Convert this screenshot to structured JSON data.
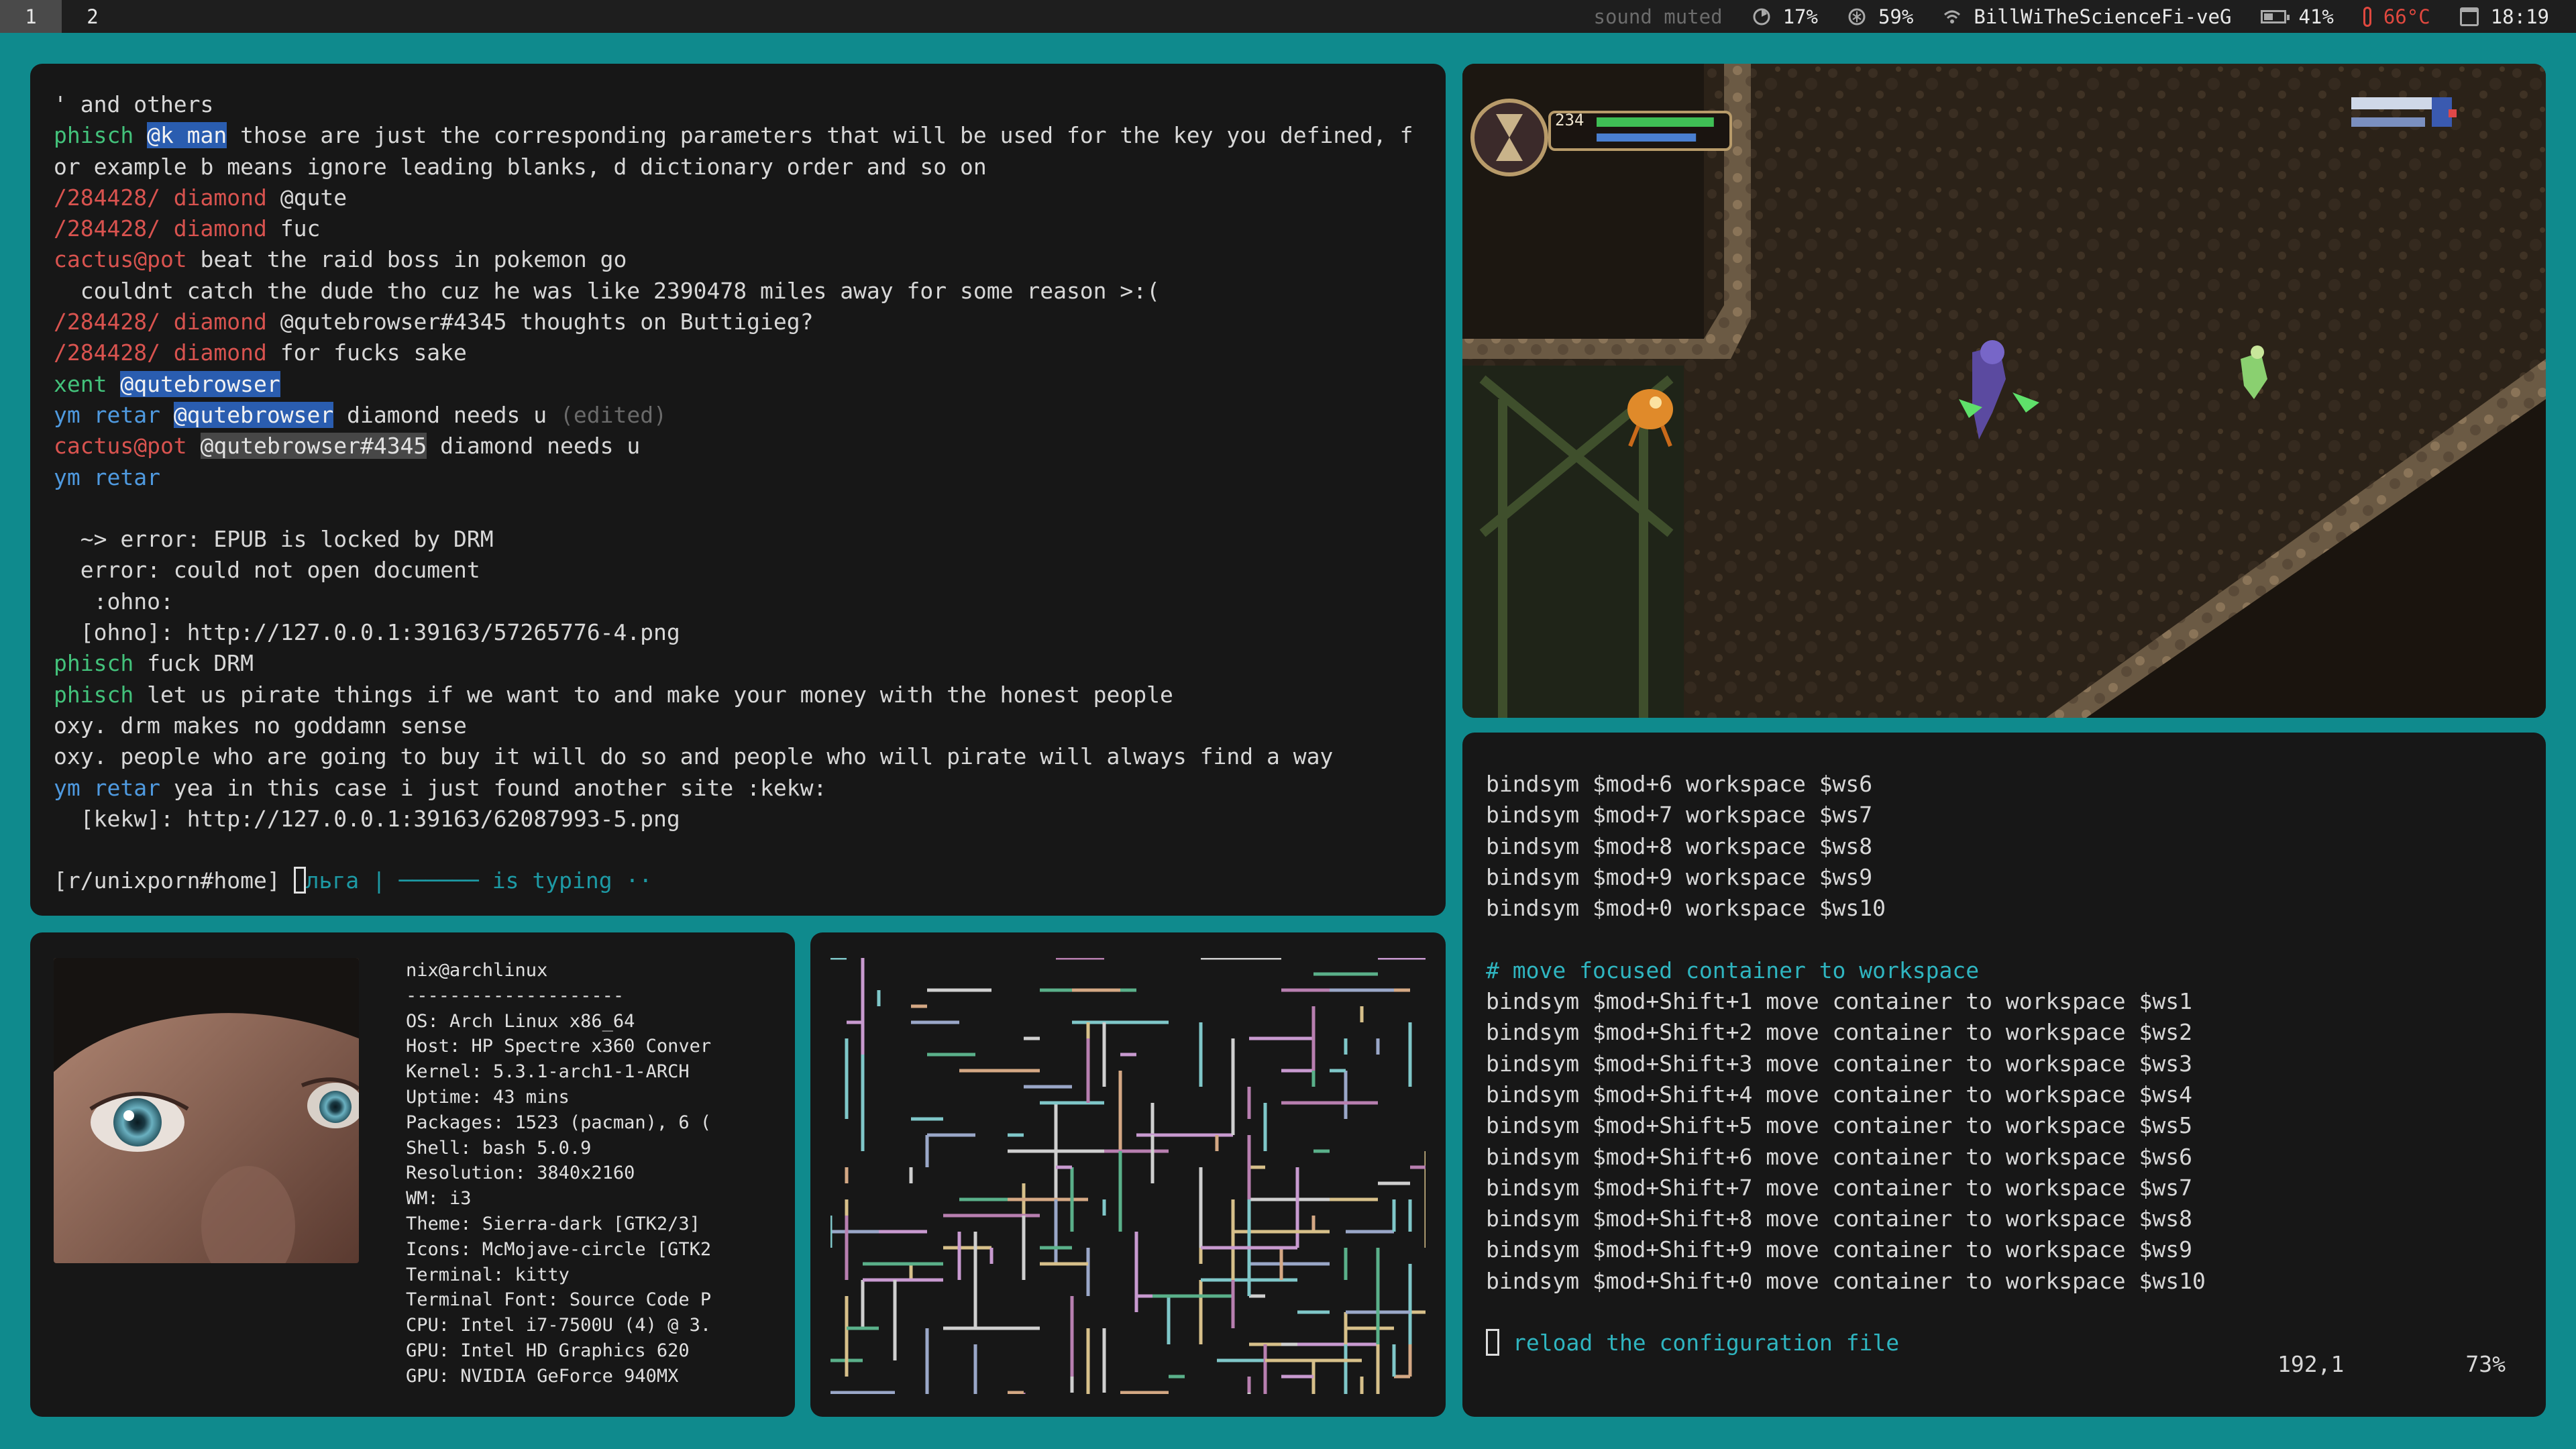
{
  "bar": {
    "workspaces": [
      "1",
      "2"
    ],
    "status": {
      "sound": "sound muted",
      "cpu": "17%",
      "mem": "59%",
      "wifi": "BillWiTheScienceFi-veG",
      "battery": "41%",
      "temp": "66°C",
      "clock": "18:19"
    },
    "icons": [
      "cpu-icon",
      "memory-icon",
      "wifi-icon",
      "battery-icon",
      "thermometer-icon",
      "calendar-icon"
    ]
  },
  "chat": {
    "lines": [
      [
        {
          "t": "' and others",
          "c": ""
        }
      ],
      [
        {
          "t": "phisch ",
          "c": "c-green"
        },
        {
          "t": "@k man",
          "c": "hl-blue"
        },
        {
          "t": " those are just the corresponding parameters that will be used for the key you defined, f",
          "c": ""
        }
      ],
      [
        {
          "t": "or example b means ignore leading blanks, d dictionary order and so on",
          "c": ""
        }
      ],
      [
        {
          "t": "/284428/ diamond ",
          "c": "c-red"
        },
        {
          "t": "@qute",
          "c": ""
        }
      ],
      [
        {
          "t": "/284428/ diamond ",
          "c": "c-red"
        },
        {
          "t": "fuc",
          "c": ""
        }
      ],
      [
        {
          "t": "cactus@pot ",
          "c": "c-red"
        },
        {
          "t": "beat the raid boss in pokemon go",
          "c": ""
        }
      ],
      [
        {
          "t": "  couldnt catch the dude tho cuz he was like 2390478 miles away for some reason >:(",
          "c": ""
        }
      ],
      [
        {
          "t": "/284428/ diamond ",
          "c": "c-red"
        },
        {
          "t": "@qutebrowser#4345 thoughts on Buttigieg?",
          "c": ""
        }
      ],
      [
        {
          "t": "/284428/ diamond ",
          "c": "c-red"
        },
        {
          "t": "for fucks sake",
          "c": ""
        }
      ],
      [
        {
          "t": "xent ",
          "c": "c-green"
        },
        {
          "t": "@qutebrowser",
          "c": "hl-blue"
        }
      ],
      [
        {
          "t": "ym retar ",
          "c": "c-blue"
        },
        {
          "t": "@qutebrowser",
          "c": "hl-blue"
        },
        {
          "t": " diamond needs u ",
          "c": ""
        },
        {
          "t": "(edited)",
          "c": "c-dim"
        }
      ],
      [
        {
          "t": "cactus@pot ",
          "c": "c-red"
        },
        {
          "t": "@qutebrowser#4345",
          "c": "hl-gray"
        },
        {
          "t": " diamond needs u",
          "c": ""
        }
      ],
      [
        {
          "t": "ym retar",
          "c": "c-blue"
        }
      ],
      [
        {
          "t": " ",
          "c": ""
        }
      ],
      [
        {
          "t": "  ~> error: EPUB is locked by DRM",
          "c": ""
        }
      ],
      [
        {
          "t": "  error: could not open document",
          "c": ""
        }
      ],
      [
        {
          "t": "   :ohno:",
          "c": ""
        }
      ],
      [
        {
          "t": "  [ohno]: http://127.0.0.1:39163/57265776-4.png",
          "c": ""
        }
      ],
      [
        {
          "t": "phisch ",
          "c": "c-green"
        },
        {
          "t": "fuck DRM",
          "c": ""
        }
      ],
      [
        {
          "t": "phisch ",
          "c": "c-green"
        },
        {
          "t": "let us pirate things if we want to and make your money with the honest people",
          "c": ""
        }
      ],
      [
        {
          "t": "oxy. ",
          "c": ""
        },
        {
          "t": "drm makes no goddamn sense",
          "c": ""
        }
      ],
      [
        {
          "t": "oxy. ",
          "c": ""
        },
        {
          "t": "people who are going to buy it will do so and people who will pirate will always find a way",
          "c": ""
        }
      ],
      [
        {
          "t": "ym retar ",
          "c": "c-blue"
        },
        {
          "t": "yea in this case i just found another site :kekw:",
          "c": ""
        }
      ],
      [
        {
          "t": "  [kekw]: http://127.0.0.1:39163/62087993-5.png",
          "c": ""
        }
      ]
    ],
    "prompt": "[r/unixporn#home] ",
    "typing_user": "льга | ────── ",
    "typing_text": "is typing ··"
  },
  "vim": {
    "lines": [
      {
        "t": "bindsym $mod+6 workspace $ws6",
        "c": ""
      },
      {
        "t": "bindsym $mod+7 workspace $ws7",
        "c": ""
      },
      {
        "t": "bindsym $mod+8 workspace $ws8",
        "c": ""
      },
      {
        "t": "bindsym $mod+9 workspace $ws9",
        "c": ""
      },
      {
        "t": "bindsym $mod+0 workspace $ws10",
        "c": ""
      },
      {
        "t": " ",
        "c": ""
      },
      {
        "t": "# move focused container to workspace",
        "c": "c-cyan"
      },
      {
        "t": "bindsym $mod+Shift+1 move container to workspace $ws1",
        "c": ""
      },
      {
        "t": "bindsym $mod+Shift+2 move container to workspace $ws2",
        "c": ""
      },
      {
        "t": "bindsym $mod+Shift+3 move container to workspace $ws3",
        "c": ""
      },
      {
        "t": "bindsym $mod+Shift+4 move container to workspace $ws4",
        "c": ""
      },
      {
        "t": "bindsym $mod+Shift+5 move container to workspace $ws5",
        "c": ""
      },
      {
        "t": "bindsym $mod+Shift+6 move container to workspace $ws6",
        "c": ""
      },
      {
        "t": "bindsym $mod+Shift+7 move container to workspace $ws7",
        "c": ""
      },
      {
        "t": "bindsym $mod+Shift+8 move container to workspace $ws8",
        "c": ""
      },
      {
        "t": "bindsym $mod+Shift+9 move container to workspace $ws9",
        "c": ""
      },
      {
        "t": "bindsym $mod+Shift+0 move container to workspace $ws10",
        "c": ""
      },
      {
        "t": " ",
        "c": ""
      }
    ],
    "cursor_line": "reload the configuration file",
    "position": "192,1",
    "percent": "73%"
  },
  "fetch": {
    "lines": [
      "nix@archlinux",
      "--------------------",
      "OS: Arch Linux x86_64",
      "Host: HP Spectre x360 Conver",
      "Kernel: 5.3.1-arch1-1-ARCH",
      "Uptime: 43 mins",
      "Packages: 1523 (pacman), 6 (",
      "Shell: bash 5.0.9",
      "Resolution: 3840x2160",
      "WM: i3",
      "Theme: Sierra-dark [GTK2/3]",
      "Icons: McMojave-circle [GTK2",
      "Terminal: kitty",
      "Terminal Font: Source Code P",
      "CPU: Intel i7-7500U (4) @ 3.",
      "GPU: Intel HD Graphics 620",
      "GPU: NVIDIA GeForce 940MX"
    ]
  },
  "game": {
    "hud_number": "234",
    "hp_fraction": 0.92,
    "mp_fraction": 0.78
  },
  "colors": {
    "desktop": "#0f8a8d",
    "window": "#171717",
    "bar": "#1e1e1e",
    "green_nick": "#43c27b",
    "red_nick": "#d9534f",
    "blue_nick": "#4f9ae0",
    "mention": "#2a5db0",
    "comment": "#2fb5c0"
  }
}
